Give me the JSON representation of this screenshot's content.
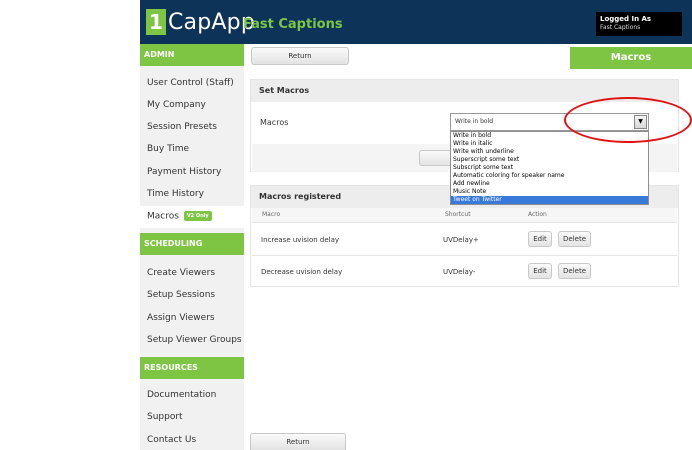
{
  "header": {
    "logo_number": "1",
    "logo_text": "CapApp",
    "app_name": "Fast Captions",
    "login_title": "Logged In As",
    "login_user": "Fast Captions"
  },
  "sidebar": {
    "admin": {
      "title": "ADMIN",
      "items": [
        {
          "label": "User Control (Staff)"
        },
        {
          "label": "My Company"
        },
        {
          "label": "Session Presets"
        },
        {
          "label": "Buy Time"
        },
        {
          "label": "Payment History"
        },
        {
          "label": "Time History"
        },
        {
          "label": "Macros",
          "badge": "V2 Only"
        }
      ]
    },
    "scheduling": {
      "title": "SCHEDULING",
      "items": [
        {
          "label": "Create Viewers"
        },
        {
          "label": "Setup Sessions"
        },
        {
          "label": "Assign Viewers"
        },
        {
          "label": "Setup Viewer Groups"
        }
      ]
    },
    "resources": {
      "title": "RESOURCES",
      "items": [
        {
          "label": "Documentation"
        },
        {
          "label": "Support"
        },
        {
          "label": "Contact Us"
        }
      ]
    }
  },
  "main": {
    "return_top": "Return",
    "return_bottom": "Return",
    "tab_title": "Macros",
    "set_macros": {
      "title": "Set Macros",
      "field_label": "Macros",
      "selected": "Write in bold",
      "options": [
        "Write in bold",
        "Write in italic",
        "Write with underline",
        "Superscript some text",
        "Subscript some text",
        "Automatic coloring for speaker name",
        "Add newline",
        "Music Note",
        "Tweet on Twitter"
      ],
      "highlighted_option": "Tweet on Twitter"
    },
    "registered": {
      "title": "Macros registered",
      "columns": [
        "Macro",
        "Shortcut",
        "Action"
      ],
      "rows": [
        {
          "macro": "Increase uvision delay",
          "shortcut": "UVDelay+",
          "edit": "Edit",
          "delete": "Delete"
        },
        {
          "macro": "Decrease uvision delay",
          "shortcut": "UVDelay-",
          "edit": "Edit",
          "delete": "Delete"
        }
      ]
    }
  },
  "colors": {
    "header_bg": "#0e3358",
    "accent_green": "#7ec544",
    "highlight_blue": "#3879d9",
    "callout_red": "#e01212"
  }
}
